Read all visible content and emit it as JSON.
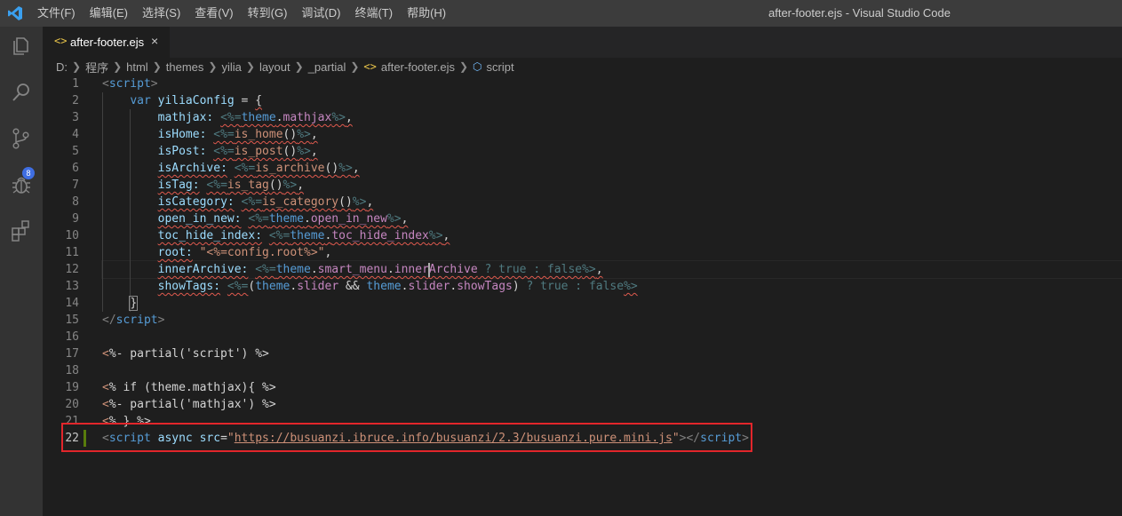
{
  "menu": [
    "文件(F)",
    "编辑(E)",
    "选择(S)",
    "查看(V)",
    "转到(G)",
    "调试(D)",
    "终端(T)",
    "帮助(H)"
  ],
  "window_title": "after-footer.ejs - Visual Studio Code",
  "activity": {
    "scm_badge": "8"
  },
  "tab": {
    "icon": "<>",
    "label": "after-footer.ejs",
    "close": "×"
  },
  "breadcrumb": {
    "parts": [
      "D:",
      "程序",
      "html",
      "themes",
      "yilia",
      "layout",
      "_partial"
    ],
    "file": "after-footer.ejs",
    "symbol": "script"
  },
  "line_numbers": [
    "1",
    "2",
    "3",
    "4",
    "5",
    "6",
    "7",
    "8",
    "9",
    "10",
    "11",
    "12",
    "13",
    "14",
    "15",
    "16",
    "17",
    "18",
    "19",
    "20",
    "21",
    "22"
  ],
  "code": {
    "l1": {
      "a": "<",
      "b": "script",
      "c": ">"
    },
    "l2": {
      "a": "var",
      "b": "yiliaConfig",
      "c": " = ",
      "d": "{"
    },
    "l3": {
      "key": "mathjax:",
      "o": "<%=",
      "v1": "theme",
      "dot": ".",
      "v2": "mathjax",
      "c": "%>",
      "e": ","
    },
    "l4": {
      "key": "isHome:",
      "o": "<%=",
      "fn": "is_home",
      "pr": "()",
      "c": "%>",
      "e": ","
    },
    "l5": {
      "key": "isPost:",
      "o": "<%=",
      "fn": "is_post",
      "pr": "()",
      "c": "%>",
      "e": ","
    },
    "l6": {
      "key": "isArchive:",
      "o": "<%=",
      "fn": "is_archive",
      "pr": "()",
      "c": "%>",
      "e": ","
    },
    "l7": {
      "key": "isTag:",
      "o": "<%=",
      "fn": "is_tag",
      "pr": "()",
      "c": "%>",
      "e": ","
    },
    "l8": {
      "key": "isCategory:",
      "o": "<%=",
      "fn": "is_category",
      "pr": "()",
      "c": "%>",
      "e": ","
    },
    "l9": {
      "key": "open_in_new:",
      "o": "<%=",
      "v1": "theme",
      "dot": ".",
      "v2": "open_in_new",
      "c": "%>",
      "e": ","
    },
    "l10": {
      "key": "toc_hide_index:",
      "o": "<%=",
      "v1": "theme",
      "dot": ".",
      "v2": "toc_hide_index",
      "c": "%>",
      "e": ","
    },
    "l11": {
      "key": "root:",
      "str": "\"<%=config.root%>\"",
      "e": ","
    },
    "l12": {
      "key": "innerArchive:",
      "o": "<%=",
      "v1": "theme",
      "d1": ".",
      "v2": "smart_menu",
      "d2": ".",
      "v3a": "inner",
      "v3b": "Archive",
      "rest": " ? true : false",
      "c": "%>",
      "e": ","
    },
    "l13": {
      "key": "showTags:",
      "o": "<%=",
      "p1": "(",
      "v1": "theme",
      "d1": ".",
      "v2": "slider",
      "amp": " && ",
      "v3": "theme",
      "d2": ".",
      "v4": "slider",
      "d3": ".",
      "v5": "showTags",
      "p2": ")",
      "rest": " ? true : false",
      "c": "%>"
    },
    "l14": {
      "a": "}"
    },
    "l15": {
      "a": "</",
      "b": "script",
      "c": ">"
    },
    "l17": {
      "a": "<",
      "b": "%- partial('script') %>"
    },
    "l19": {
      "a": "<",
      "b": "% if (theme.mathjax){ %>"
    },
    "l20": {
      "a": "<",
      "b": "%- partial('mathjax') %>"
    },
    "l21": {
      "a": "<",
      "b": "% } %>"
    },
    "l22": {
      "a": "<",
      "tag": "script",
      "attr1": " async",
      "attr2": " src",
      "eq": "=",
      "q1": "\"",
      "url": "https://busuanzi.ibruce.info/busuanzi/2.3/busuanzi.pure.mini.js",
      "q2": "\"",
      "end": "></",
      "tag2": "script",
      "gt": ">"
    }
  },
  "colors": {
    "red_box": "#e2262b",
    "accent": "#007acc"
  }
}
